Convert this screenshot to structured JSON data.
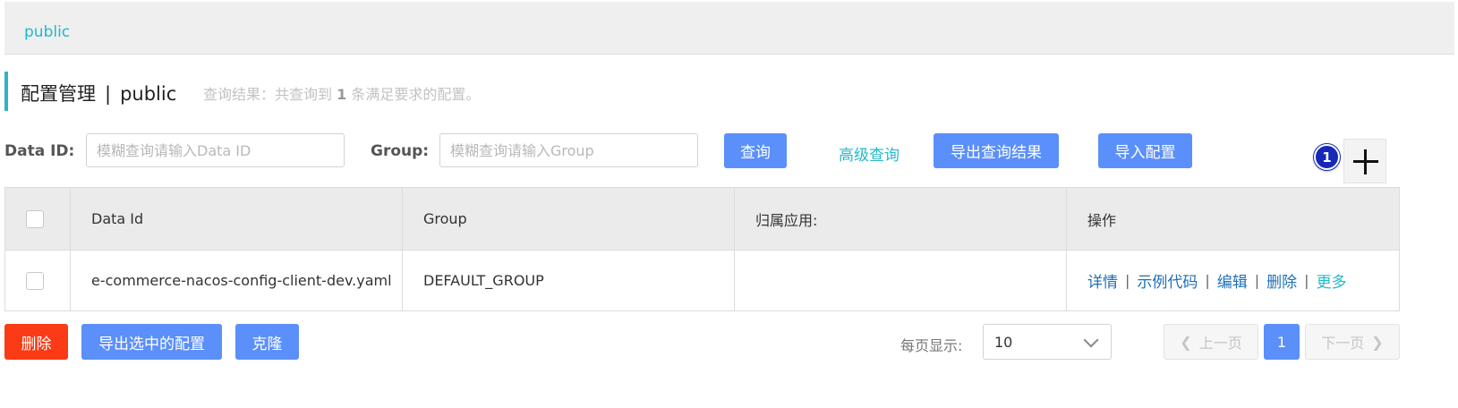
{
  "namespace_bar": {
    "items": [
      {
        "label": "public"
      }
    ]
  },
  "header": {
    "title": "配置管理",
    "separator": "|",
    "namespace": "public",
    "summary_prefix": "查询结果：共查询到",
    "summary_count": "1",
    "summary_suffix": "条满足要求的配置。"
  },
  "search": {
    "data_id_label": "Data ID:",
    "data_id_value": "",
    "data_id_placeholder": "模糊查询请输入Data ID",
    "group_label": "Group:",
    "group_value": "",
    "group_placeholder": "模糊查询请输入Group",
    "query_button": "查询",
    "advanced_link": "高级查询",
    "export_results_button": "导出查询结果",
    "import_button": "导入配置"
  },
  "add": {
    "icon": "plus-icon",
    "badge": "1"
  },
  "table": {
    "columns": [
      "Data Id",
      "Group",
      "归属应用:",
      "操作"
    ],
    "rows": [
      {
        "data_id": "e-commerce-nacos-config-client-dev.yaml",
        "group": "DEFAULT_GROUP",
        "app": "",
        "actions": [
          "详情",
          "示例代码",
          "编辑",
          "删除",
          "更多"
        ],
        "action_separator": "|"
      }
    ]
  },
  "bulk": {
    "delete_button": "删除",
    "export_selected_button": "导出选中的配置",
    "clone_button": "克隆"
  },
  "pagination": {
    "page_size_label": "每页显示:",
    "page_size": "10",
    "prev": "上一页",
    "current": "1",
    "next": "下一页"
  },
  "colors": {
    "primary": "#5b8ff9",
    "danger": "#fa3b16",
    "teal": "#25b9c9",
    "link": "#1f6fb8",
    "badge": "#1528b8"
  }
}
